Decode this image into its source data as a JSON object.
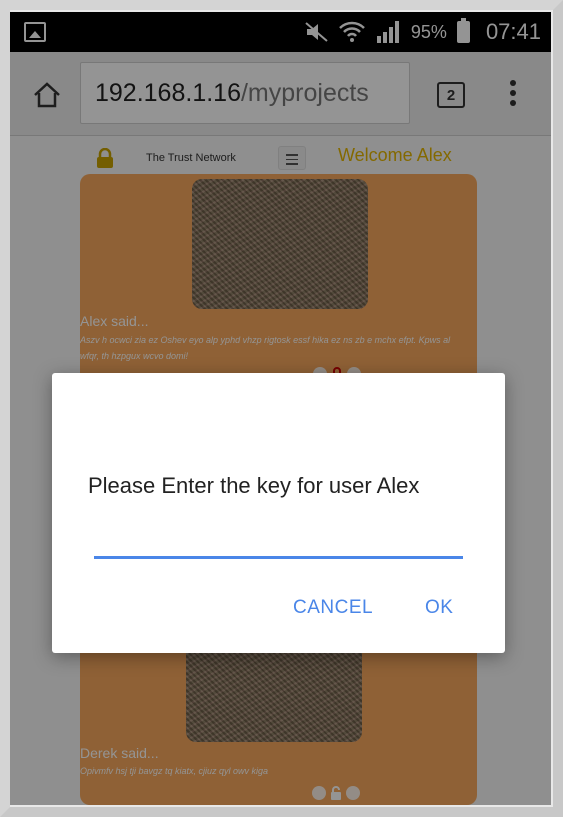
{
  "status_bar": {
    "battery_percent": "95%",
    "time": "07:41",
    "icons": [
      "gallery-icon",
      "mute-icon",
      "wifi-icon",
      "signal-icon",
      "battery-icon"
    ]
  },
  "browser": {
    "url_host": "192.168.1.16",
    "url_path": "/myprojects",
    "tab_count": "2",
    "icons": [
      "home-icon",
      "tabs-icon",
      "more-vert-icon"
    ]
  },
  "site": {
    "brand": "The Trust Network",
    "welcome": "Welcome Alex",
    "icons": [
      "lock-icon",
      "hamburger-icon"
    ]
  },
  "posts": [
    {
      "author": "Alex said...",
      "text": "Aszv h ocwci zia ez Oshev eyo alp yphd vhzp rigtosk essf hika ez ns zb e mchx efpt. Kpws al wfqr, th hzpgux wcvo domi!"
    },
    {
      "author": "Derek said...",
      "text": "Opivmfv hsj tji bavgz tq kiatx, cjiuz qyl owv kiga"
    }
  ],
  "dialog": {
    "message": "Please Enter the key for user Alex",
    "input_value": "",
    "cancel_label": "CANCEL",
    "ok_label": "OK"
  },
  "colors": {
    "accent": "#4a86e8",
    "post_bg": "#f6a85d",
    "welcome": "#e3b600"
  }
}
